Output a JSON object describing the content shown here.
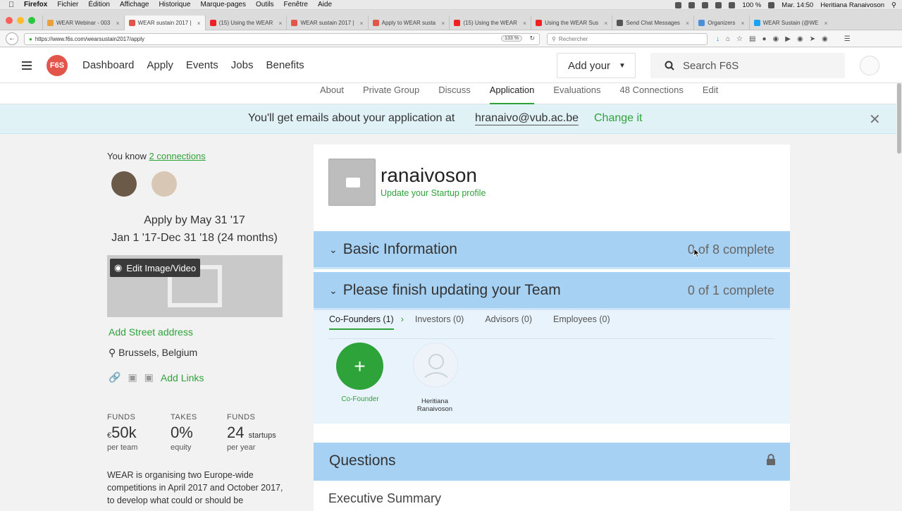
{
  "mac_menu": {
    "app": "Firefox",
    "items": [
      "Fichier",
      "Édition",
      "Affichage",
      "Historique",
      "Marque-pages",
      "Outils",
      "Fenêtre",
      "Aide"
    ],
    "battery": "100 %",
    "clock": "Mar. 14:50",
    "user": "Heritiana Ranaivoson"
  },
  "browser": {
    "tabs": [
      {
        "label": "WEAR Webinar - 003",
        "color": "#e8a23b"
      },
      {
        "label": "WEAR sustain 2017 |",
        "color": "#e2554a",
        "active": true
      },
      {
        "label": "(15) Using the WEAR",
        "color": "#e22"
      },
      {
        "label": "WEAR sustain 2017 |",
        "color": "#e2554a"
      },
      {
        "label": "Apply to WEAR susta",
        "color": "#e2554a"
      },
      {
        "label": "(15) Using the WEAR",
        "color": "#e22"
      },
      {
        "label": "Using the WEAR Sus",
        "color": "#e22"
      },
      {
        "label": "Send Chat Messages",
        "color": "#555"
      },
      {
        "label": "Organizers",
        "color": "#4a8fd8"
      },
      {
        "label": "WEAR Sustain (@WE",
        "color": "#1da1f2"
      }
    ],
    "url": "https://www.f6s.com/wearsustain2017/apply",
    "zoom": "133 %",
    "search_placeholder": "Rechercher"
  },
  "header": {
    "logo": "F6S",
    "nav": [
      "Dashboard",
      "Apply",
      "Events",
      "Jobs",
      "Benefits"
    ],
    "add_your": "Add your",
    "search_placeholder": "Search F6S"
  },
  "subnav": {
    "items": [
      "About",
      "Private Group",
      "Discuss",
      "Application",
      "Evaluations",
      "48 Connections",
      "Edit"
    ],
    "active_index": 3
  },
  "banner": {
    "message": "You'll get emails about your application at",
    "email": "hranaivo@vub.ac.be",
    "change": "Change it"
  },
  "sidebar": {
    "you_know": "You know",
    "connections_link": "2 connections",
    "apply_by": "Apply by May 31 '17",
    "period": "Jan 1 '17-Dec 31 '18 (24 months)",
    "edit_media": "Edit Image/Video",
    "add_street": "Add Street address",
    "location": "Brussels, Belgium",
    "add_links": "Add Links",
    "stats": [
      {
        "label": "FUNDS",
        "value": "50k",
        "prefix": "€",
        "suffix": "",
        "sub": "per team"
      },
      {
        "label": "TAKES",
        "value": "0%",
        "prefix": "",
        "suffix": "",
        "sub": "equity"
      },
      {
        "label": "FUNDS",
        "value": "24",
        "prefix": "",
        "suffix": "startups",
        "sub": "per year"
      }
    ],
    "description": "WEAR is organising two Europe-wide competitions in April 2017 and October 2017, to develop what could or should be"
  },
  "startup": {
    "name": "ranaivoson",
    "update_link": "Update your Startup profile"
  },
  "sections": {
    "basic": {
      "title": "Basic Information",
      "status": "0 of 8 complete"
    },
    "team": {
      "title": "Please finish updating your Team",
      "status": "0 of 1 complete"
    }
  },
  "team": {
    "tabs": [
      "Co-Founders (1)",
      "Investors (0)",
      "Advisors (0)",
      "Employees (0)"
    ],
    "add_label": "Co-Founder",
    "member_name_line1": "Heritiana",
    "member_name_line2": "Ranaivoson"
  },
  "questions": {
    "title": "Questions",
    "first_question": "Executive Summary"
  }
}
